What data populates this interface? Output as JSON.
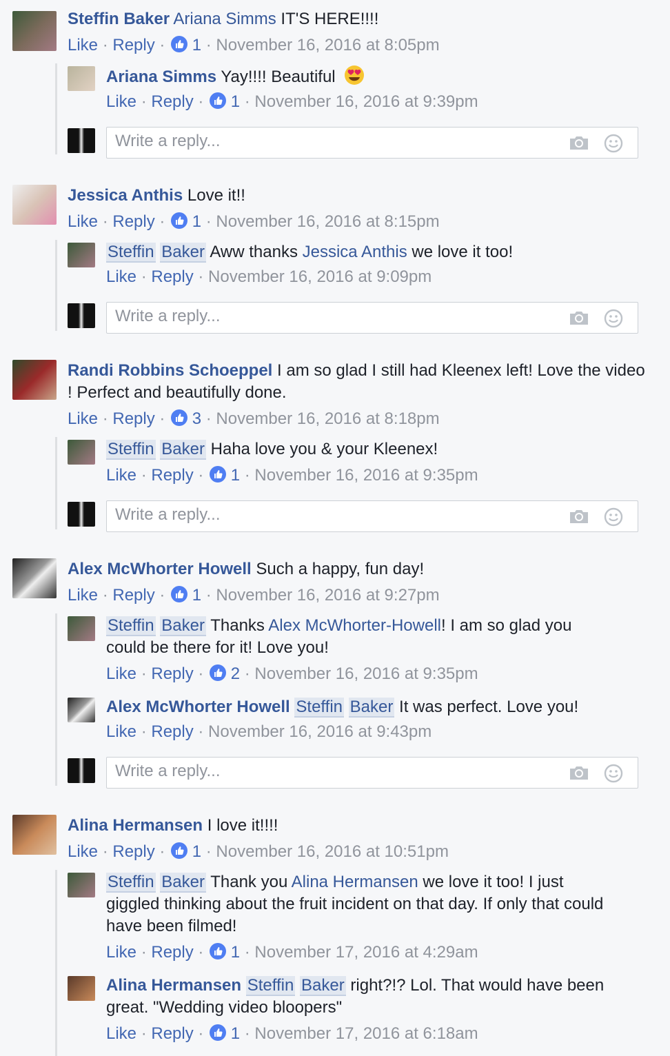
{
  "actions": {
    "like": "Like",
    "reply": "Reply",
    "dot": " · "
  },
  "composer_placeholder": "Write a reply...",
  "comments": [
    {
      "author": "Steffin Baker",
      "mention": "Ariana Simms",
      "text": " IT'S HERE!!!!",
      "likes": "1",
      "time": "November 16, 2016 at 8:05pm",
      "replies": [
        {
          "author": "Ariana Simms",
          "text": " Yay!!!! Beautiful",
          "likes": "1",
          "time": "November 16, 2016 at 9:39pm"
        }
      ]
    },
    {
      "author": "Jessica Anthis",
      "text": " Love it!!",
      "likes": "1",
      "time": "November 16, 2016 at 8:15pm",
      "replies": [
        {
          "tag1": "Steffin",
          "tag2": "Baker",
          "text1": " Aww thanks ",
          "mention": "Jessica Anthis",
          "text2": " we love it too!",
          "time": "November 16, 2016 at 9:09pm"
        }
      ]
    },
    {
      "author": "Randi Robbins Schoeppel",
      "text": " I am so glad I still had Kleenex left! Love the video",
      "text_line2": "! Perfect and beautifully done.",
      "likes": "3",
      "time": "November 16, 2016 at 8:18pm",
      "replies": [
        {
          "tag1": "Steffin",
          "tag2": "Baker",
          "text": " Haha love you & your Kleenex!",
          "likes": "1",
          "time": "November 16, 2016 at 9:35pm"
        }
      ]
    },
    {
      "author": "Alex McWhorter Howell",
      "text": " Such a happy, fun day!",
      "likes": "1",
      "time": "November 16, 2016 at 9:27pm",
      "replies": [
        {
          "tag1": "Steffin",
          "tag2": "Baker",
          "text1": " Thanks ",
          "mention": "Alex McWhorter-Howell",
          "text2": "! I am so glad you",
          "text_line2": "could be there for it! Love you!",
          "likes": "2",
          "time": "November 16, 2016 at 9:35pm"
        },
        {
          "author": "Alex McWhorter Howell",
          "tag1": "Steffin",
          "tag2": "Baker",
          "text": " It was perfect. Love you!",
          "time": "November 16, 2016 at 9:43pm"
        }
      ]
    },
    {
      "author": "Alina Hermansen",
      "text": " I love it!!!!",
      "likes": "1",
      "time": "November 16, 2016 at 10:51pm",
      "replies": [
        {
          "tag1": "Steffin",
          "tag2": "Baker",
          "text1": " Thank you ",
          "mention": "Alina Hermansen",
          "text2": " we love it too! I just",
          "text_line2": "giggled thinking about the fruit incident on that day. If only that could",
          "text_line3": "have been filmed!",
          "likes": "1",
          "time": "November 17, 2016 at 4:29am"
        },
        {
          "author": "Alina Hermansen",
          "tag1": "Steffin",
          "tag2": "Baker",
          "text": " right?!? Lol. That would have been",
          "text_line2": "great. \"Wedding video bloopers\"",
          "likes": "1",
          "time": "November 17, 2016 at 6:18am"
        }
      ]
    }
  ],
  "colors": {
    "link": "#365899",
    "meta": "#90949c",
    "like_badge": "#4f7ef2",
    "background": "#f6f7f9"
  }
}
